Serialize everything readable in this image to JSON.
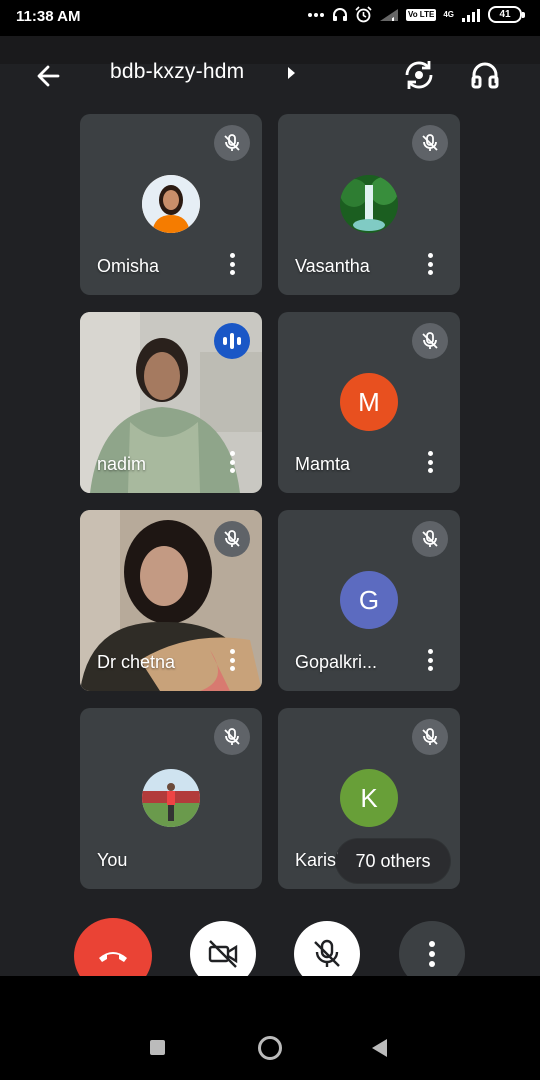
{
  "status_bar": {
    "time": "11:38 AM",
    "network_label": "4G",
    "volte_label": "Vo LTE",
    "battery": "41"
  },
  "header": {
    "title": "bdb-kxzy-hdm"
  },
  "participants": [
    {
      "name": "Omisha",
      "avatar_type": "photo",
      "avatar_color": "#f57c00",
      "mic": "muted"
    },
    {
      "name": "Vasantha",
      "avatar_type": "photo",
      "avatar_color": "#2e7d32",
      "mic": "muted"
    },
    {
      "name": "nadim",
      "avatar_type": "video",
      "mic": "speaking"
    },
    {
      "name": "Mamta",
      "avatar_type": "letter",
      "letter": "M",
      "avatar_color": "#e8501f",
      "mic": "muted"
    },
    {
      "name": "Dr chetna",
      "avatar_type": "video",
      "mic": "muted"
    },
    {
      "name": "Gopalkri...",
      "avatar_type": "letter",
      "letter": "G",
      "avatar_color": "#5c6bc0",
      "mic": "muted"
    },
    {
      "name": "You",
      "avatar_type": "photo",
      "avatar_color": "#6a9a4c",
      "mic": "muted"
    },
    {
      "name": "Karish",
      "avatar_type": "letter",
      "letter": "K",
      "avatar_color": "#689f38",
      "mic": "muted"
    }
  ],
  "others_count_label": "70 others",
  "controls": {
    "end_call_color": "#ea4335",
    "icons": [
      "end-call-icon",
      "camera-off-icon",
      "mic-off-icon",
      "more-vert-icon"
    ]
  }
}
